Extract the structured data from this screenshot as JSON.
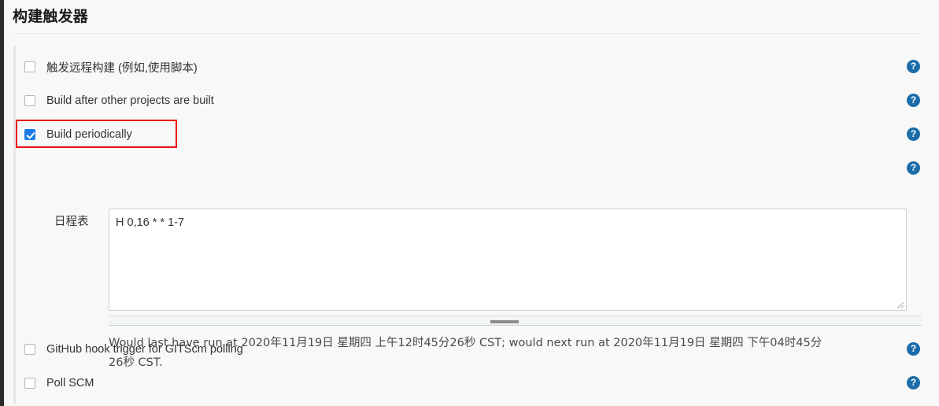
{
  "page": {
    "title": "构建触发器",
    "accent_blue": "#1e7ce8",
    "help_icon_blue": "#1b6ca8",
    "annotation_red": "#ee1111"
  },
  "triggers": [
    {
      "id": "trigger-remote-build",
      "label": "触发远程构建 (例如,使用脚本)",
      "checked": false,
      "help": "?",
      "highlighted": false
    },
    {
      "id": "trigger-after-other-projects",
      "label": "Build after other projects are built",
      "checked": false,
      "help": "?",
      "highlighted": false
    },
    {
      "id": "trigger-build-periodically",
      "label": "Build periodically",
      "checked": true,
      "help": "?",
      "highlighted": true
    },
    {
      "id": "trigger-github-hook",
      "label": "GitHub hook trigger for GITScm polling",
      "checked": false,
      "help": "?",
      "highlighted": false
    },
    {
      "id": "trigger-poll-scm",
      "label": "Poll SCM",
      "checked": false,
      "help": "?",
      "highlighted": false
    }
  ],
  "schedule": {
    "label": "日程表",
    "value": "H 0,16 * * 1-7",
    "help": "?",
    "status_line_1": "Would last have run at 2020年11月19日 星期四 上午12时45分26秒 CST; would next run at 2020年11月19日 星期四 下午04时45分",
    "status_line_2": "26秒 CST."
  }
}
